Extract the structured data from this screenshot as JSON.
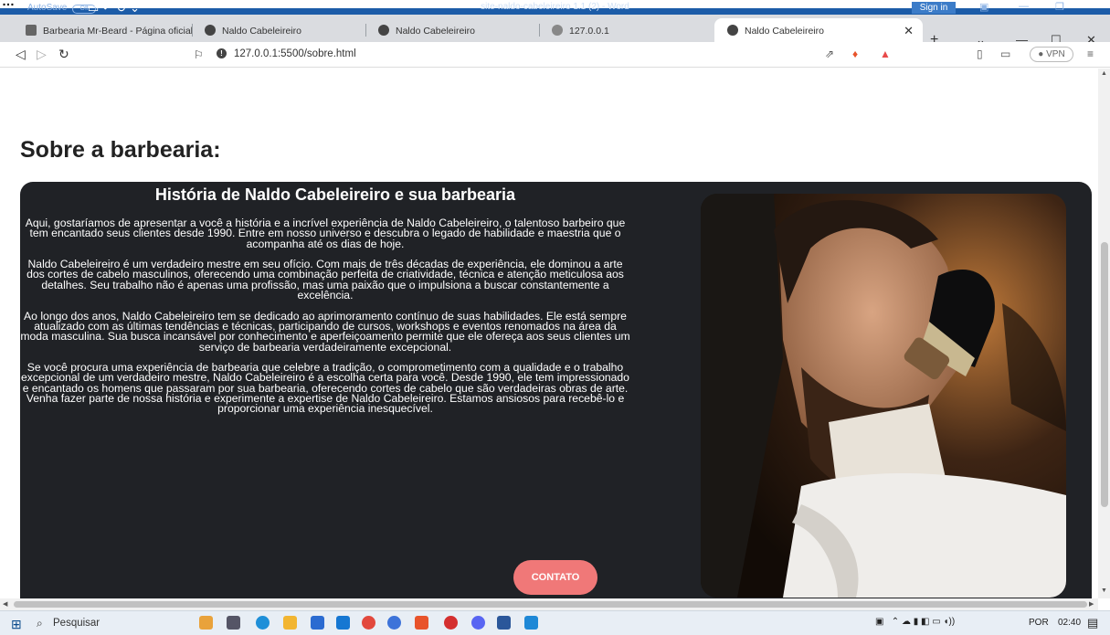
{
  "word": {
    "autosave_label": "AutoSave",
    "autosave_state": "Off",
    "document_title": "site-naldo-cabeleireiro 1.1 (2)  -  Word",
    "signin_label": "Sign in"
  },
  "browser": {
    "tabs": [
      {
        "label": "Barbearia Mr-Beard - Página oficial",
        "active": false
      },
      {
        "label": "Naldo Cabeleireiro",
        "active": false
      },
      {
        "label": "Naldo Cabeleireiro",
        "active": false
      },
      {
        "label": "127.0.0.1",
        "active": false
      },
      {
        "label": "Naldo Cabeleireiro",
        "active": true
      }
    ],
    "url": "127.0.0.1:5500/sobre.html",
    "vpn_label": "VPN"
  },
  "page": {
    "heading": "Sobre a barbearia:",
    "section_title": "História de Naldo Cabeleireiro e sua barbearia",
    "paragraphs": [
      "Aqui, gostaríamos de apresentar a você a história e a incrível experiência de Naldo Cabeleireiro, o talentoso barbeiro que tem encantado seus clientes desde 1990. Entre em nosso universo e descubra o legado de habilidade e maestria que o acompanha até os dias de hoje.",
      "Naldo Cabeleireiro é um verdadeiro mestre em seu ofício. Com mais de três décadas de experiência, ele dominou a arte dos cortes de cabelo masculinos, oferecendo uma combinação perfeita de criatividade, técnica e atenção meticulosa aos detalhes. Seu trabalho não é apenas uma profissão, mas uma paixão que o impulsiona a buscar constantemente a excelência.",
      "Ao longo dos anos, Naldo Cabeleireiro tem se dedicado ao aprimoramento contínuo de suas habilidades. Ele está sempre atualizado com as últimas tendências e técnicas, participando de cursos, workshops e eventos renomados na área da moda masculina. Sua busca incansável por conhecimento e aperfeiçoamento permite que ele ofereça aos seus clientes um serviço de barbearia verdadeiramente excepcional.",
      "Se você procura uma experiência de barbearia que celebre a tradição, o comprometimento com a qualidade e o trabalho excepcional de um verdadeiro mestre, Naldo Cabeleireiro é a escolha certa para você. Desde 1990, ele tem impressionado e encantado os homens que passaram por sua barbearia, oferecendo cortes de cabelo que são verdadeiras obras de arte. Venha fazer parte de nossa história e experimente a expertise de Naldo Cabeleireiro. Estamos ansiosos para recebê-lo e proporcionar uma experiência inesquecível."
    ],
    "contact_button": "CONTATO",
    "colors": {
      "card_bg": "#202226",
      "button_bg": "#f07878"
    }
  },
  "taskbar": {
    "search_label": "Pesquisar",
    "language": "POR",
    "time": "02:40"
  }
}
